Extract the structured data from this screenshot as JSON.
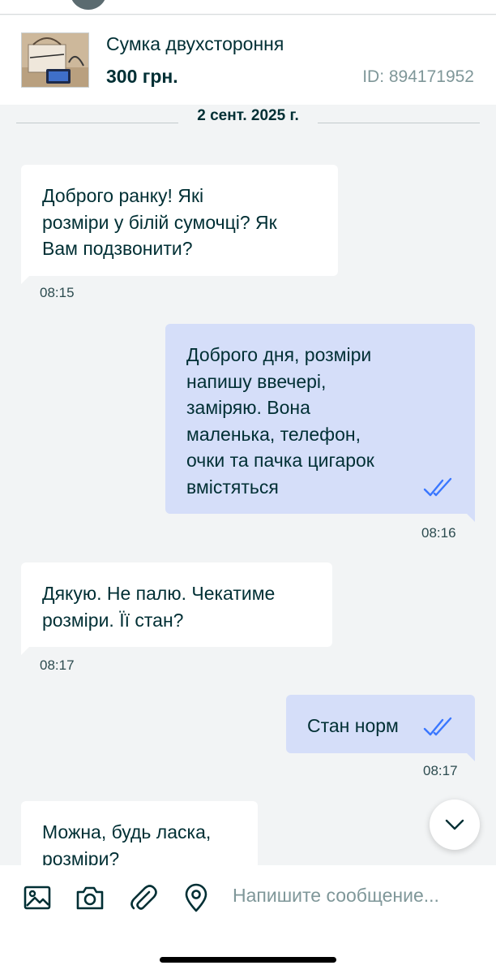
{
  "product": {
    "title": "Сумка двухстороння",
    "price": "300 грн.",
    "id": "ID: 894171952"
  },
  "date_separator": "2 сент. 2025 г.",
  "messages": [
    {
      "direction": "in",
      "lines": [
        "Доброго ранку! Які",
        "розміри у білій сумочці? Як",
        "Вам подзвонити?"
      ],
      "time": "08:15"
    },
    {
      "direction": "out",
      "lines": [
        "Доброго дня, розміри",
        "напишу ввечері,",
        "заміряю. Вона",
        "маленька, телефон,",
        "очки та пачка цигарок",
        "вмістяться"
      ],
      "time": "08:16",
      "status": "read"
    },
    {
      "direction": "in",
      "lines": [
        "Дякую. Не палю. Чекатиме",
        "розміри. Її стан?"
      ],
      "time": "08:17"
    },
    {
      "direction": "out",
      "lines": [
        "Стан норм"
      ],
      "time": "08:17",
      "status": "read"
    },
    {
      "direction": "in",
      "lines": [
        "Можна, будь ласка,",
        "розміри?"
      ]
    }
  ],
  "composer": {
    "placeholder": "Напишите сообщение..."
  },
  "colors": {
    "outgoing_bubble": "#d5def9",
    "incoming_bubble": "#ffffff",
    "background": "#f2f4f5",
    "read_checks": "#3a77ff",
    "text": "#002f34"
  },
  "icons": [
    "image-icon",
    "camera-icon",
    "paperclip-icon",
    "location-pin-icon",
    "chevron-down-icon",
    "double-check-icon"
  ]
}
